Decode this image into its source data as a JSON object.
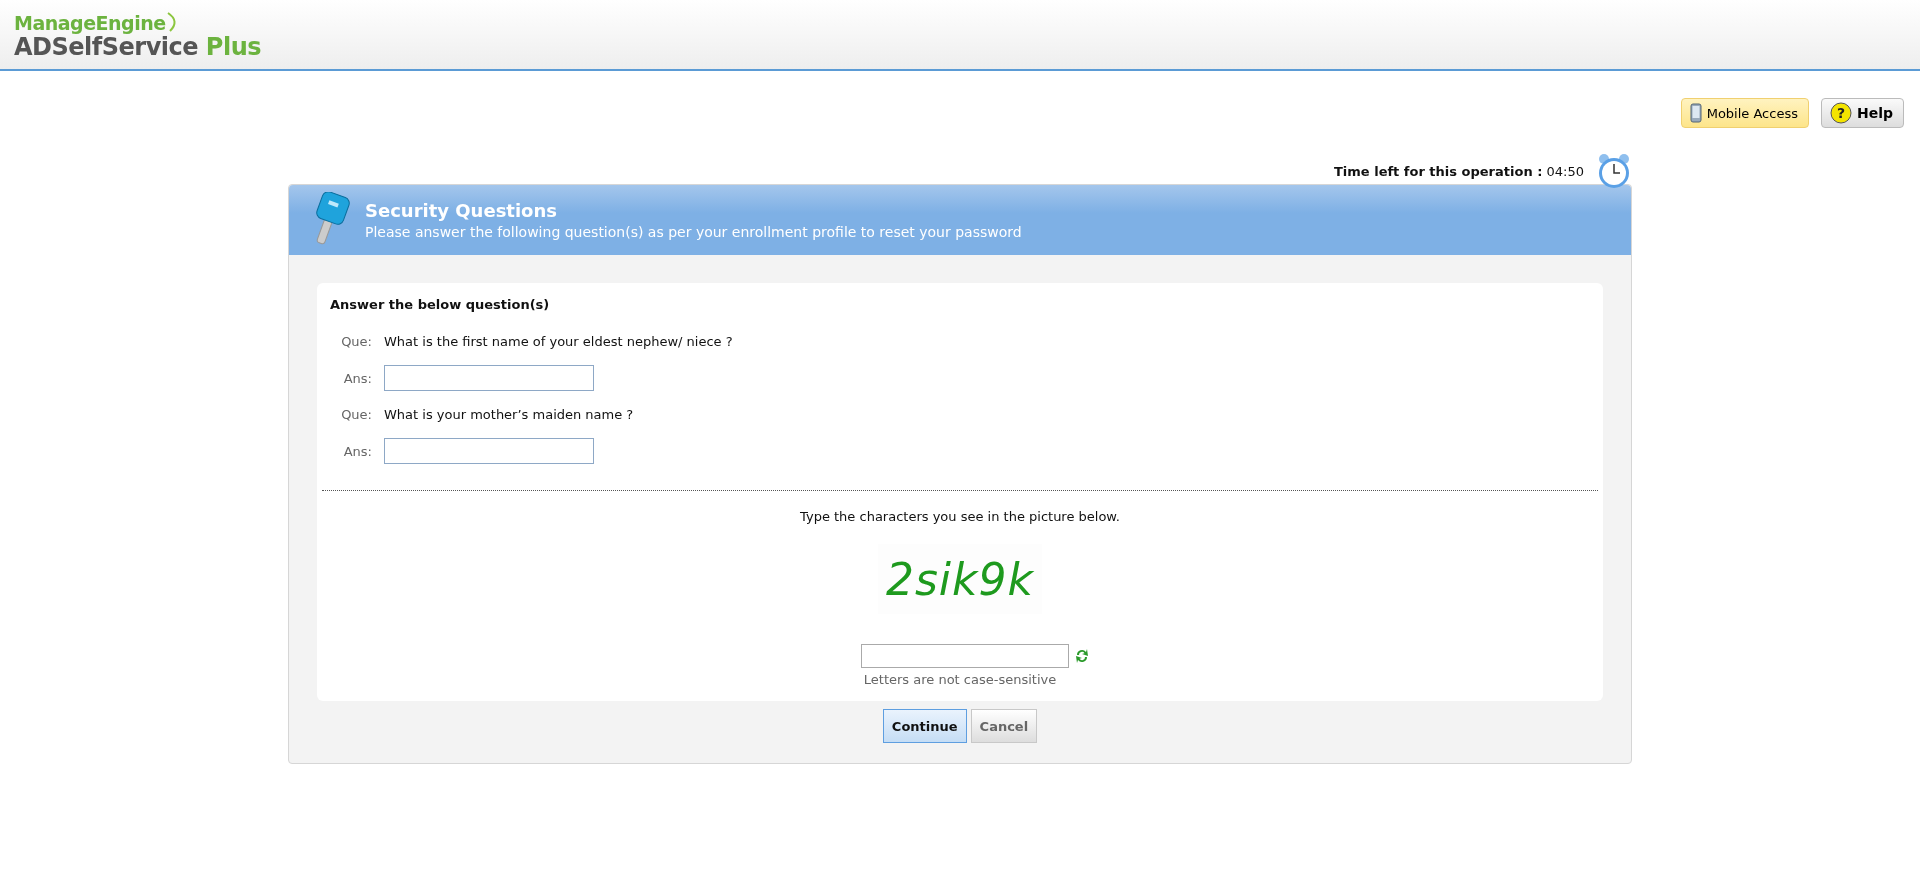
{
  "logo": {
    "brand": "ManageEngine",
    "product": "ADSelfService",
    "edition": "Plus"
  },
  "top_buttons": [
    {
      "kind": "mobile",
      "label": "Mobile Access"
    },
    {
      "kind": "help",
      "label": "Help",
      "glyph": "?"
    }
  ],
  "timer": {
    "label": "Time left for this operation :",
    "value": "04:50"
  },
  "panel": {
    "title": "Security Questions",
    "subtitle": "Please answer the following question(s) as per your enrollment profile to reset your password"
  },
  "form": {
    "heading": "Answer the below question(s)",
    "questions": [
      {
        "que_label": "Que:",
        "question": "What is the first name of your eldest nephew/ niece ?",
        "ans_label": "Ans:"
      },
      {
        "que_label": "Que:",
        "question": "What is your mother’s maiden name ?",
        "ans_label": "Ans:"
      }
    ]
  },
  "captcha": {
    "instruction": "Type the characters you see in the picture below.",
    "text": "2sik9k",
    "hint": "Letters are not case-sensitive"
  },
  "buttons": [
    {
      "label": "Continue",
      "kind": "primary"
    },
    {
      "label": "Cancel",
      "kind": "secondary"
    }
  ]
}
